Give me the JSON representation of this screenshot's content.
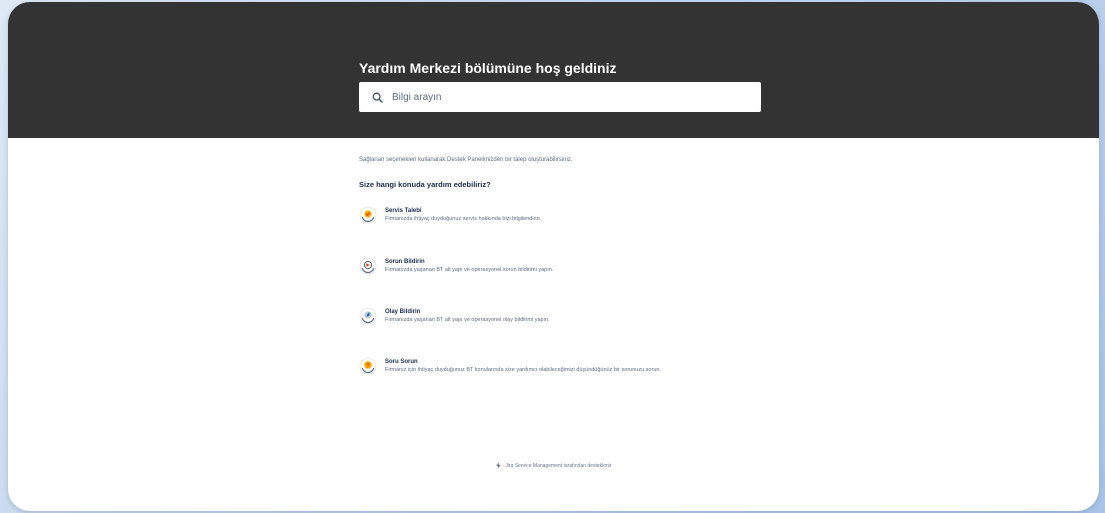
{
  "hero": {
    "title": "Yardım Merkezi bölümüne hoş geldiniz",
    "search_placeholder": "Bilgi arayın",
    "background": "#333333"
  },
  "main": {
    "intro": "Sağlanan seçenekleri kullanarak Destek Panelimizden bir talep oluşturabilirsiniz.",
    "question": "Size hangi konuda yardım edebiliriz?",
    "options": [
      {
        "title": "Servis Talebi",
        "description": "Firmanızda ihtiyaç duyduğunuz servis hakkında bizi bilgilendirin.",
        "icon": "service-request-icon"
      },
      {
        "title": "Sorun Bildirin",
        "description": "Firmanızda yaşanan BT alt yapı ve operasyonel sorun bildirimi yapın.",
        "icon": "report-problem-icon"
      },
      {
        "title": "Olay Bildirin",
        "description": "Firmanızda yaşanan BT alt yapı ve operasyonel olay bildirimi yapın.",
        "icon": "report-incident-icon"
      },
      {
        "title": "Soru Sorun",
        "description": "Firmanız için ihtiyaç duyduğunuz BT konularında size yardımcı olabileceğimizi düşündüğünüz bir sorunuzu sorun.",
        "icon": "question-icon"
      }
    ]
  },
  "footer": {
    "text": "Jira Service Management tarafından desteklenir",
    "icon": "jira-lightning-icon"
  }
}
